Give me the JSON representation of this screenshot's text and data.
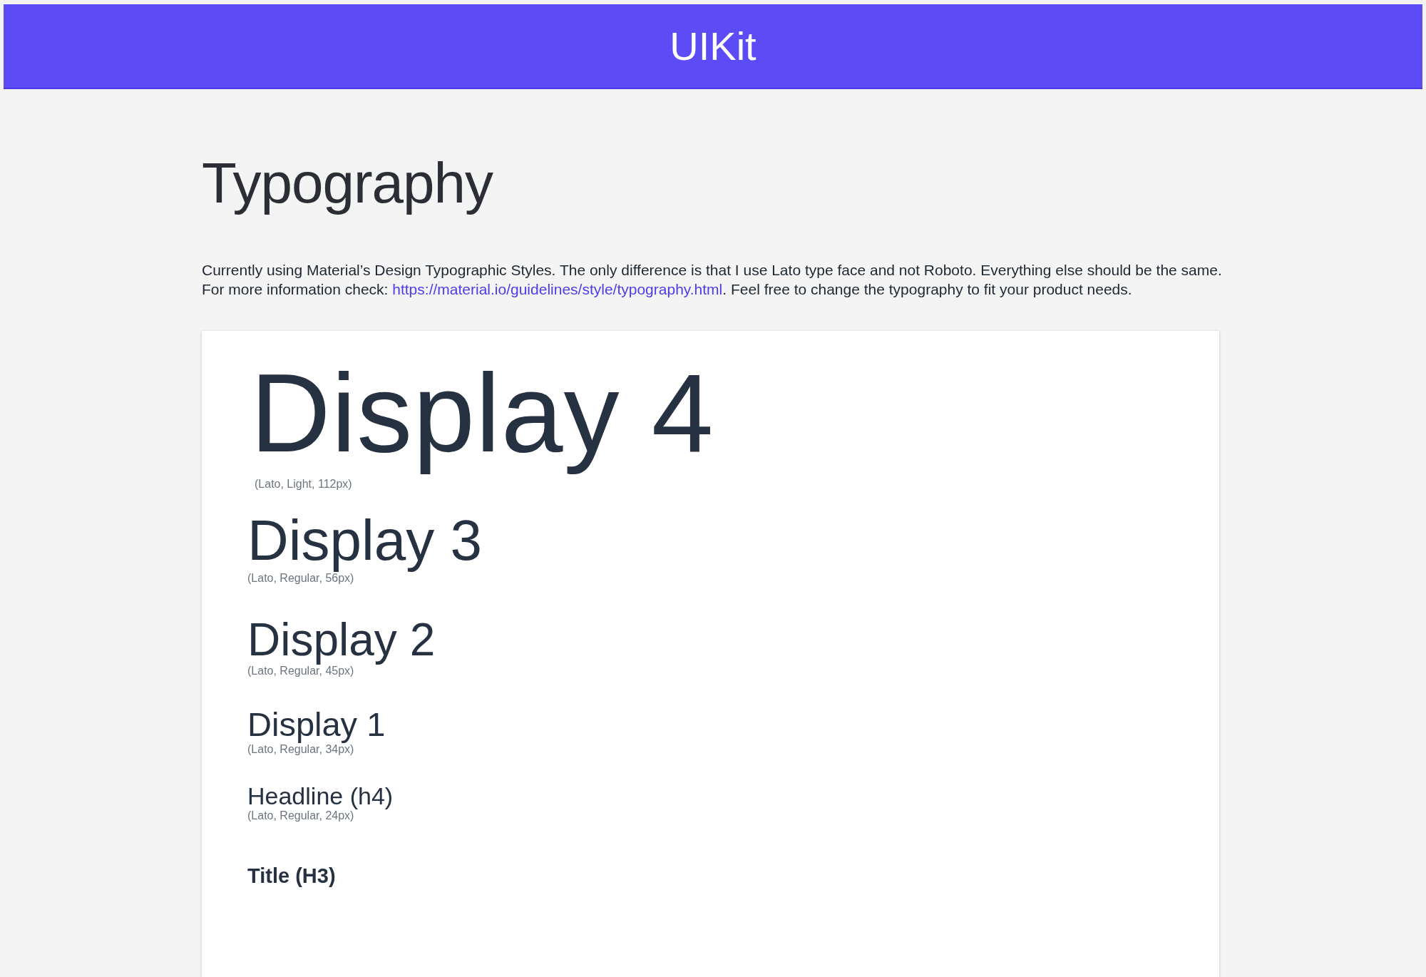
{
  "header": {
    "title": "UIKit"
  },
  "page": {
    "heading": "Typography",
    "intro": {
      "before": "Currently using Material’s Design Typographic Styles. The only difference is that I use Lato type face and not Roboto. Everything else should be the same. For more information check: ",
      "link": "https://material.io/guidelines/style/typography.html",
      "after": ". Feel free to change the typography to fit your product needs."
    }
  },
  "samples": [
    {
      "kind": "display4",
      "text": "Display 4",
      "caption": "(Lato, Light, 112px)"
    },
    {
      "kind": "display3",
      "text": "Display 3",
      "caption": "(Lato, Regular, 56px)"
    },
    {
      "kind": "display2",
      "text": "Display 2",
      "caption": "(Lato, Regular, 45px)"
    },
    {
      "kind": "display1",
      "text": "Display 1",
      "caption": "(Lato, Regular, 34px)"
    },
    {
      "kind": "headline",
      "text": "Headline (h4)",
      "caption": "(Lato, Regular, 24px)"
    },
    {
      "kind": "title",
      "text": "Title (H3)"
    }
  ]
}
